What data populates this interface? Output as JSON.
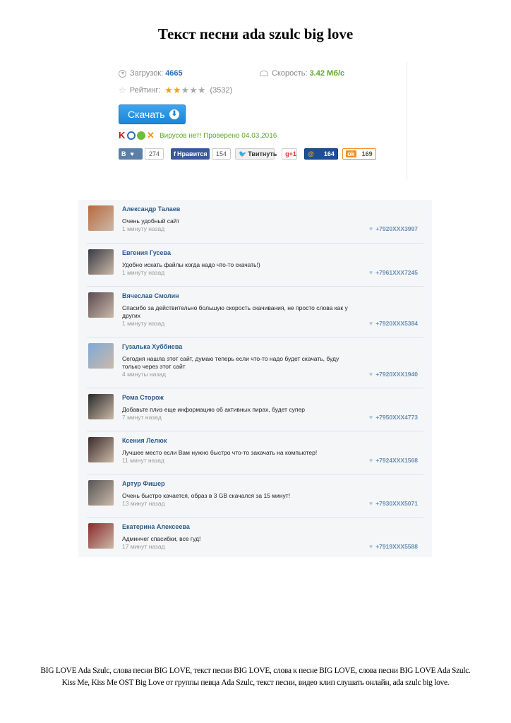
{
  "title": "Текст песни ada szulc big love",
  "download": {
    "downloads_label": "Загрузок:",
    "downloads_value": "4665",
    "speed_label": "Скорость:",
    "speed_value": "3.42 Мб/с",
    "rating_label": "Рейтинг:",
    "rating_stars": 2,
    "rating_max": 5,
    "rating_count": "(3532)",
    "button_label": "Скачать",
    "antivirus_text": "Вирусов нет! Проверено 04.03.2016"
  },
  "share": {
    "vk_label": "В",
    "vk_count": "274",
    "fb_label": "Нравится",
    "fb_count": "154",
    "tw_label": "Твитнуть",
    "gp_label": "g+1",
    "mr_label": "@",
    "mr_count": "164",
    "ok_label": "ok",
    "ok_count": "169"
  },
  "comments": [
    {
      "name": "Александр Талаев",
      "text": "Очень удобный сайт",
      "time": "1 минуту назад",
      "phone": "+7920XXX3997",
      "color": "#b86a3c"
    },
    {
      "name": "Евгения Гусева",
      "text": "Удобно искать файлы когда надо что-то скачать!)",
      "time": "1 минуту назад",
      "phone": "+7961XXX7245",
      "color": "#3a3a44"
    },
    {
      "name": "Вячеслав Смолин",
      "text": "Спасибо за действительно большую скорость скачивания, не просто слова как у других",
      "time": "1 минуту назад",
      "phone": "+7920XXX5384",
      "color": "#5a4a52"
    },
    {
      "name": "Гузалька Хуббиева",
      "text": "Сегодня нашла этот сайт, думаю теперь если что-то надо будет скачать, буду только через этот сайт",
      "time": "4 минуты назад",
      "phone": "+7920XXX1940",
      "color": "#7fa9d8"
    },
    {
      "name": "Рома Сторож",
      "text": "Добавьте плиз еще информацию об активных пирах, будет супер",
      "time": "7 минут назад",
      "phone": "+7950XXX4773",
      "color": "#2a2a2a"
    },
    {
      "name": "Ксения Лелюк",
      "text": "Лучшее место если Вам нужно быстро что-то закачать на компьютер!",
      "time": "11 минут назад",
      "phone": "+7924XXX1568",
      "color": "#3b2b2b"
    },
    {
      "name": "Артур Фишер",
      "text": "Очень быстро качается, образ в 3 GB скачался за 15 минут!",
      "time": "13 минут назад",
      "phone": "+7930XXX5071",
      "color": "#555555"
    },
    {
      "name": "Екатерина Алексеева",
      "text": "Админчег спасибки, все гуд!",
      "time": "17 минут назад",
      "phone": "+7919XXX5588",
      "color": "#8a2a2a"
    }
  ],
  "footer": {
    "line1": "BIG LOVE Ada Szulc, слова песни BIG LOVE, текст песни BIG LOVE, слова к песне BIG LOVE, слова песни BIG LOVE Ada Szulc.",
    "line2": "Kiss Me, Kiss Me OST Big Love от группы певца Ada Szulc, текст песни, видео клип слушать онлайн, ada szulc big love."
  }
}
